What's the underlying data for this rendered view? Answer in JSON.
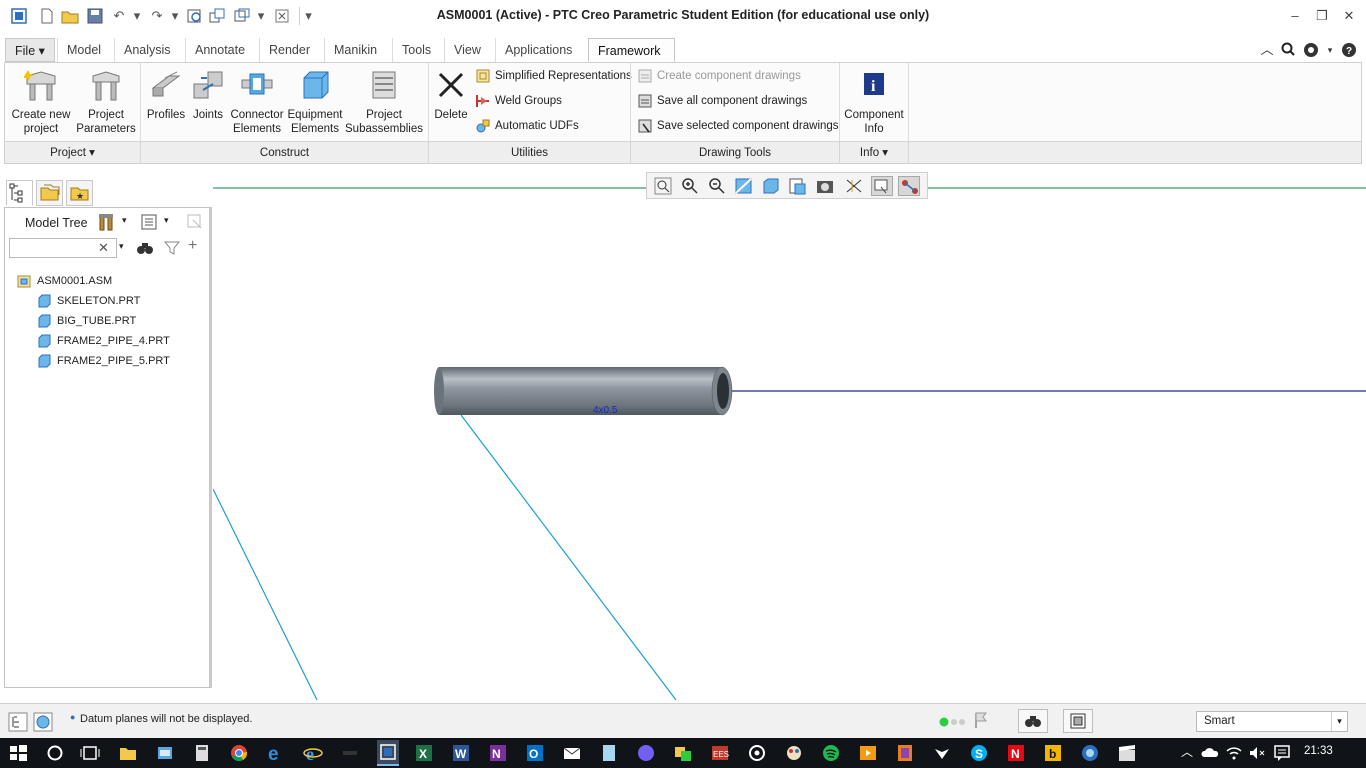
{
  "window": {
    "title": "ASM0001 (Active) - PTC Creo Parametric Student Edition (for educational use only)"
  },
  "ribbon_tabs": {
    "file": "File",
    "model": "Model",
    "analysis": "Analysis",
    "annotate": "Annotate",
    "render": "Render",
    "manikin": "Manikin",
    "tools": "Tools",
    "view": "View",
    "applications": "Applications",
    "framework": "Framework"
  },
  "ribbon": {
    "create_new_project": [
      "Create new",
      "project"
    ],
    "project_parameters": [
      "Project",
      "Parameters"
    ],
    "profiles": "Profiles",
    "joints": "Joints",
    "connector_elements": [
      "Connector",
      "Elements"
    ],
    "equipment_elements": [
      "Equipment",
      "Elements"
    ],
    "project_subassemblies": [
      "Project",
      "Subassemblies"
    ],
    "delete": "Delete",
    "simplified_representations": "Simplified Representations",
    "weld_groups": "Weld Groups",
    "automatic_udfs": "Automatic UDFs",
    "create_component_drawings": "Create component drawings",
    "save_all_component_drawings": "Save all component drawings",
    "save_selected_component_drawings": "Save selected component drawings",
    "component_info": [
      "Component",
      "Info"
    ]
  },
  "ribbon_groups": {
    "project": "Project",
    "construct": "Construct",
    "utilities": "Utilities",
    "drawing_tools": "Drawing Tools",
    "info": "Info"
  },
  "model_tree": {
    "label": "Model Tree",
    "search_value": "",
    "items": [
      {
        "name": "ASM0001.ASM",
        "type": "assembly"
      },
      {
        "name": "SKELETON.PRT",
        "type": "part"
      },
      {
        "name": "BIG_TUBE.PRT",
        "type": "part"
      },
      {
        "name": "FRAME2_PIPE_4.PRT",
        "type": "part"
      },
      {
        "name": "FRAME2_PIPE_5.PRT",
        "type": "part"
      }
    ]
  },
  "graphics": {
    "tube_label": "4x0.5"
  },
  "status": {
    "message": "Datum planes will not be displayed.",
    "selection_filter": "Smart"
  },
  "taskbar": {
    "clock": "21:33"
  },
  "colors": {
    "accent_blue": "#2d6fbf",
    "datum_green": "#3a9a6a",
    "skeleton_line": "#1aa0d0",
    "axis_line": "#1a2a8a"
  }
}
